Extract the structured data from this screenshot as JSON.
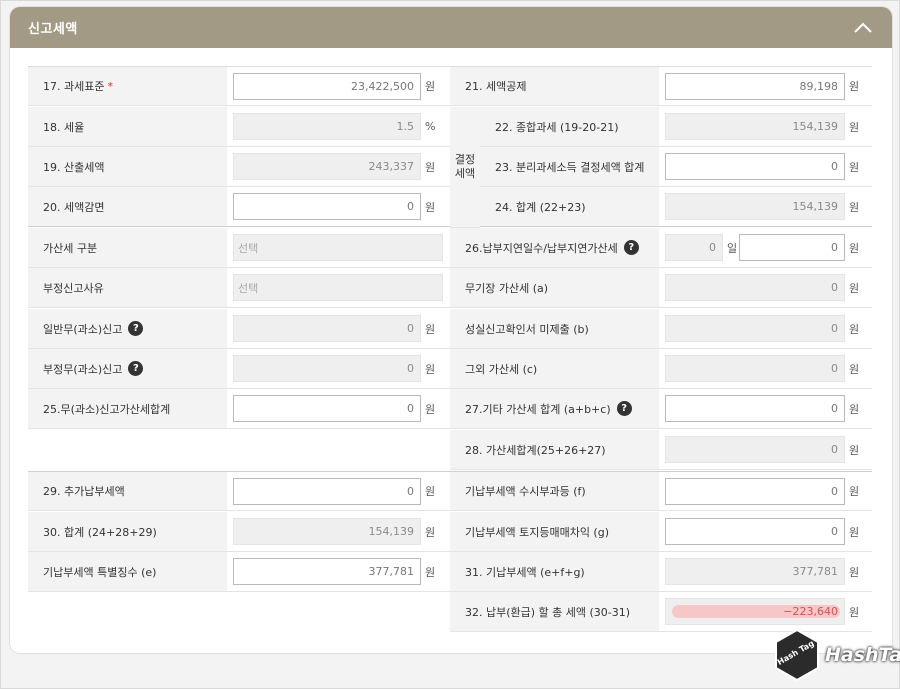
{
  "panel": {
    "title": "신고세액"
  },
  "left_rows": [
    {
      "label": "17. 과세표준",
      "required": "*",
      "value": "23,422,500",
      "unit": "원"
    },
    {
      "label": "18. 세율",
      "value": "1.5",
      "unit": "%"
    },
    {
      "label": "19. 산출세액",
      "value": "243,337",
      "unit": "원"
    },
    {
      "label": "20. 세액감면",
      "value": "0",
      "unit": "원"
    },
    {
      "label": "가산세 구분",
      "value": "선택"
    },
    {
      "label": "부정신고사유",
      "value": "선택"
    },
    {
      "label": "일반무(과소)신고",
      "value": "0",
      "unit": "원"
    },
    {
      "label": "부정무(과소)신고",
      "value": "0",
      "unit": "원"
    },
    {
      "label": "25.무(과소)신고가산세합계",
      "value": "0",
      "unit": "원"
    },
    {
      "label": "29. 추가납부세액",
      "value": "0",
      "unit": "원"
    },
    {
      "label": "30. 합계 (24+28+29)",
      "value": "154,139",
      "unit": "원"
    },
    {
      "label": "기납부세액 특별징수 (e)",
      "value": "377,781",
      "unit": "원"
    }
  ],
  "right_rows": [
    {
      "label": "21. 세액공제",
      "value": "89,198",
      "unit": "원"
    },
    {
      "label": "22. 종합과세 (19-20-21)",
      "value": "154,139",
      "unit": "원"
    },
    {
      "label": "23. 분리과세소득 결정세액 합계",
      "value": "0",
      "unit": "원"
    },
    {
      "label": "24. 합계 (22+23)",
      "value": "154,139",
      "unit": "원"
    },
    {
      "label": "26.납부지연일수/납부지연가산세",
      "days_value": "0",
      "days_unit": "일",
      "value": "0",
      "unit": "원"
    },
    {
      "label": "무기장 가산세 (a)",
      "value": "0",
      "unit": "원"
    },
    {
      "label": "성실신고확인서 미제출 (b)",
      "value": "0",
      "unit": "원"
    },
    {
      "label": "그외 가산세 (c)",
      "value": "0",
      "unit": "원"
    },
    {
      "label": "27.기타 가산세 합계 (a+b+c)",
      "value": "0",
      "unit": "원"
    },
    {
      "label": "28. 가산세합계(25+26+27)",
      "value": "0",
      "unit": "원"
    },
    {
      "label": "기납부세액 수시부과등 (f)",
      "value": "0",
      "unit": "원"
    },
    {
      "label": "기납부세액 토지등매매차익 (g)",
      "value": "0",
      "unit": "원"
    },
    {
      "label": "31. 기납부세액 (e+f+g)",
      "value": "377,781",
      "unit": "원"
    },
    {
      "label": "32. 납부(환급) 할 총 세액 (30-31)",
      "value": "−223,640",
      "unit": "원"
    }
  ],
  "group": {
    "label": "결정세액"
  },
  "help_icon_glyph": "?",
  "watermark": {
    "text": "HashTag",
    "badge_text": "Hash Tag"
  },
  "colors": {
    "header": "#a39a86",
    "label_bg": "#f3f3f3",
    "negative_highlight": "#f7c7c7"
  }
}
